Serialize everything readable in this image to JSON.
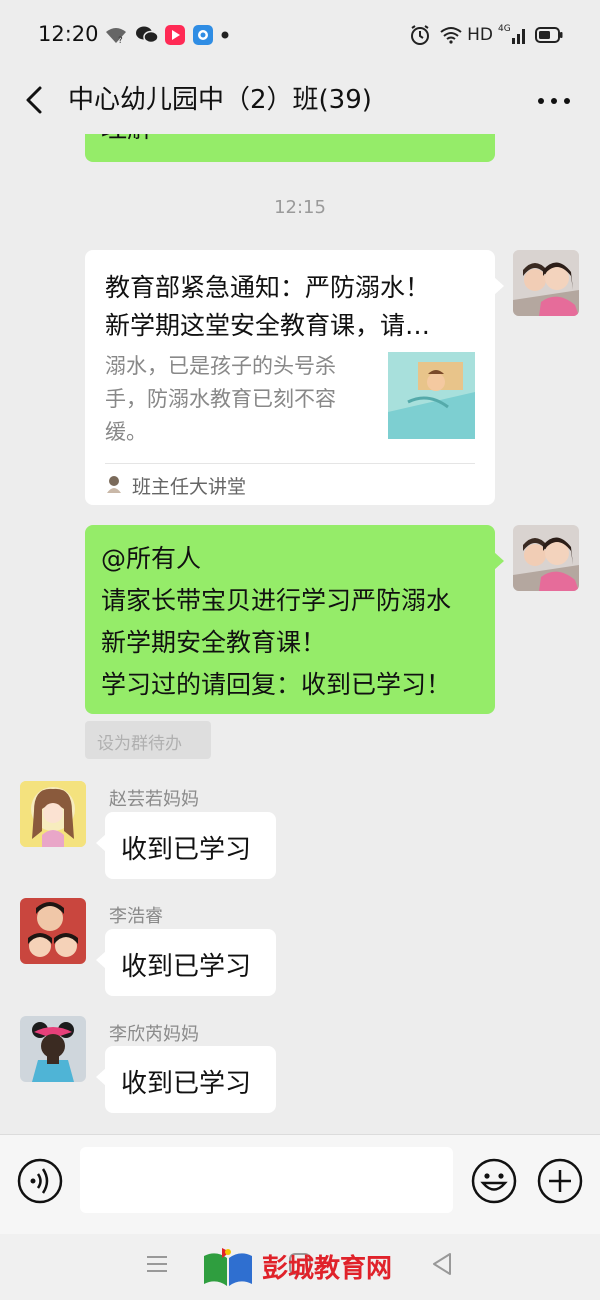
{
  "status_bar": {
    "time": "12:20",
    "network_label": "HD",
    "signal_label": "4G"
  },
  "header": {
    "title": "中心幼儿园中（2）班(39)"
  },
  "chat": {
    "prev_fragment": "理解",
    "timestamp": "12:15",
    "link_card": {
      "title_line1": "教育部紧急通知：严防溺水！",
      "title_line2": "新学期这堂安全教育课，请…",
      "desc_line1": "溺水，已是孩子的头号杀",
      "desc_line2": "手，防溺水教育已刻不容",
      "desc_line3": "缓。",
      "source": "班主任大讲堂"
    },
    "announcement": {
      "line1": "@所有人",
      "line2": "请家长带宝贝进行学习严防溺水",
      "line3": "新学期安全教育课！",
      "line4": "学习过的请回复：收到已学习！"
    },
    "todo_button": "设为群待办",
    "replies": [
      {
        "sender": "赵芸若妈妈",
        "text": "收到已学习"
      },
      {
        "sender": "李浩睿",
        "text": "收到已学习"
      },
      {
        "sender": "李欣芮妈妈",
        "text": "收到已学习"
      }
    ]
  },
  "watermark": {
    "text": "彭城教育网"
  },
  "colors": {
    "chat_bg": "#ededed",
    "self_bubble": "#95ec69",
    "other_bubble": "#ffffff",
    "watermark_red": "#e0222a"
  }
}
